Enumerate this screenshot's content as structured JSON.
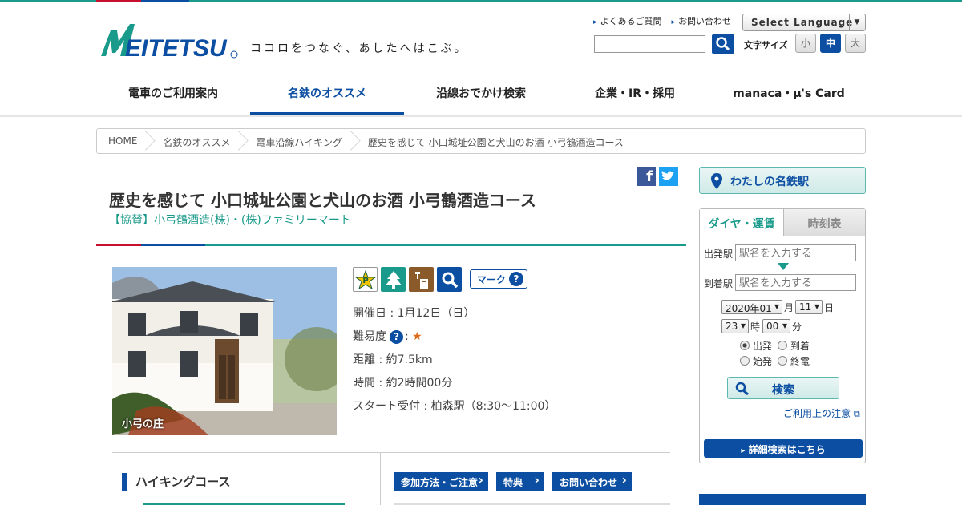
{
  "header": {
    "logo_text": "MEITETSU",
    "tagline": "ココロをつなぐ、あしたへはこぶ。",
    "links": [
      "よくあるご質問",
      "お問い合わせ"
    ],
    "language_select": "Select Language",
    "font_size_label": "文字サイズ",
    "font_sizes": [
      "小",
      "中",
      "大"
    ]
  },
  "nav": {
    "items": [
      "電車のご利用案内",
      "名鉄のオススメ",
      "沿線おでかけ検索",
      "企業・IR・採用",
      "manaca・μ's Card"
    ],
    "active_index": 1
  },
  "breadcrumb": [
    "HOME",
    "名鉄のオススメ",
    "電車沿線ハイキング",
    "歴史を感じて 小口城址公園と犬山のお酒 小弓鶴酒造コース"
  ],
  "article": {
    "title": "歴史を感じて 小口城址公園と犬山のお酒 小弓鶴酒造コース",
    "sponsor": "【協賛】小弓鶴酒造(株)・(株)ファミリーマート",
    "photo_caption": "小弓の庄",
    "mark_button": "マーク",
    "info": {
      "date": "開催日 : 1月12日（日）",
      "difficulty_label": "難易度",
      "difficulty_stars": "★",
      "distance": "距離 : 約7.5km",
      "time": "時間 : 約2時間00分",
      "start": "スタート受付 : 柏森駅（8:30～11:00）"
    }
  },
  "lower": {
    "hiking_course": "ハイキングコース",
    "buttons": [
      "参加方法・ご注意",
      "特典",
      "お問い合わせ"
    ]
  },
  "sidebar": {
    "my_station": "わたしの名鉄駅",
    "tabs": [
      "ダイヤ・運賃",
      "時刻表"
    ],
    "from_label": "出発駅",
    "to_label": "到着駅",
    "station_placeholder": "駅名を入力する",
    "year_month": "2020年01",
    "month_unit": "月",
    "day": "11",
    "day_unit": "日",
    "hour": "23",
    "hour_unit": "時",
    "minute": "00",
    "minute_unit": "分",
    "radios": [
      "出発",
      "到着",
      "始発",
      "終電"
    ],
    "search": "検索",
    "note": "ご利用上の注意",
    "detail": "詳細検索はこちら"
  },
  "colors": {
    "brand_blue": "#0b4ea2",
    "brand_teal": "#1a9a8a",
    "brand_red": "#c8102e"
  }
}
